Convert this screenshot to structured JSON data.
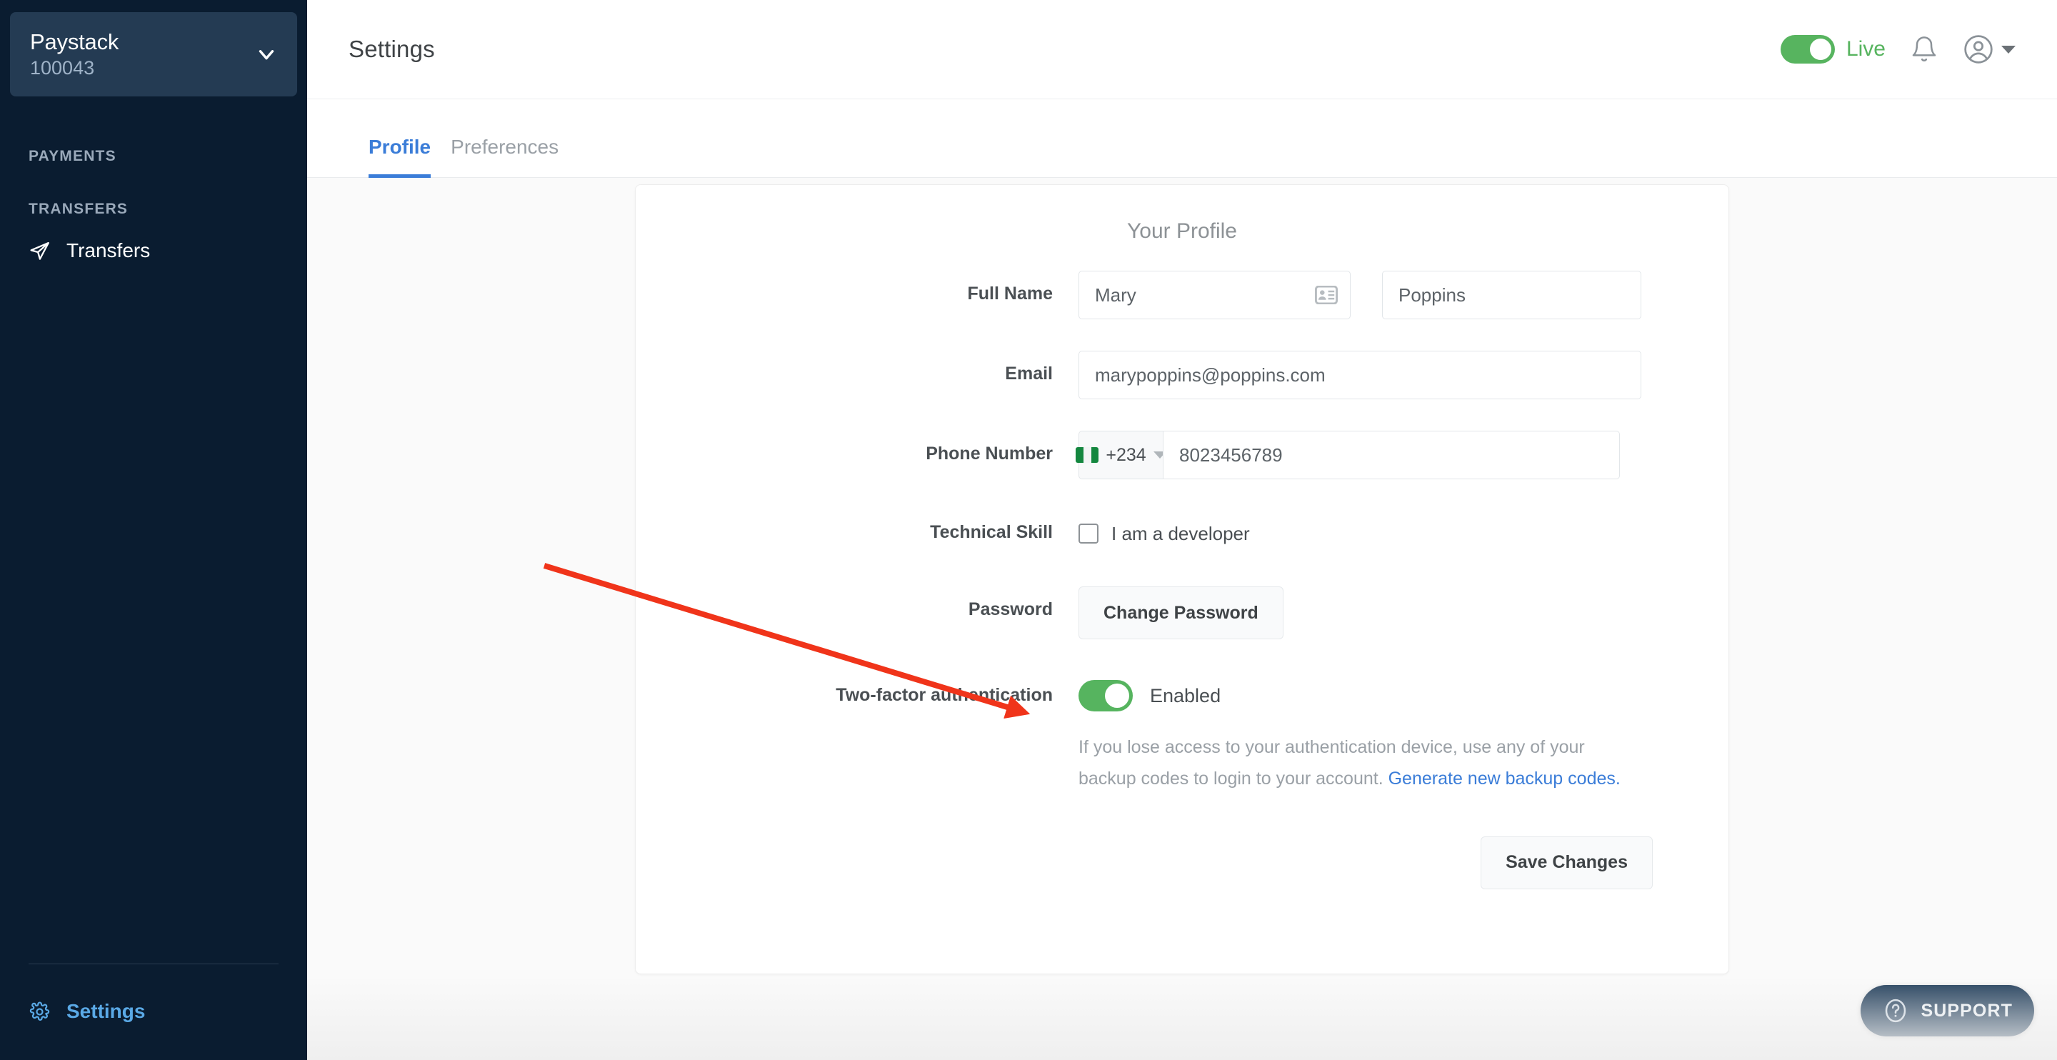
{
  "sidebar": {
    "account": {
      "name": "Paystack",
      "id": "100043",
      "chevron_icon": "chevron-down-icon"
    },
    "sections": [
      {
        "label": "PAYMENTS",
        "items": []
      },
      {
        "label": "TRANSFERS",
        "items": [
          {
            "label": "Transfers",
            "icon": "send-icon"
          }
        ]
      }
    ],
    "bottom": {
      "label": "Settings",
      "icon": "gear-icon"
    }
  },
  "header": {
    "title": "Settings",
    "mode_toggle": {
      "label": "Live",
      "state": "on",
      "color": "#57b45f"
    },
    "notifications_icon": "bell-icon",
    "account_icon": "user-circle-icon",
    "account_caret_icon": "caret-down-icon"
  },
  "tabs": [
    {
      "label": "Profile",
      "active": true
    },
    {
      "label": "Preferences",
      "active": false
    }
  ],
  "profile": {
    "card_title": "Your Profile",
    "full_name": {
      "label": "Full Name",
      "first_value": "Mary",
      "last_value": "Poppins",
      "autofill_icon": "contact-card-icon"
    },
    "email": {
      "label": "Email",
      "value": "marypoppins@poppins.com"
    },
    "phone": {
      "label": "Phone Number",
      "country_code": "+234",
      "flag_icon": "nigeria-flag-icon",
      "caret_icon": "caret-down-icon",
      "value": "8023456789"
    },
    "technical_skill": {
      "label": "Technical Skill",
      "checkbox_label": "I am a developer",
      "checked": false
    },
    "password": {
      "label": "Password",
      "button_label": "Change Password"
    },
    "two_factor": {
      "label": "Two-factor authentication",
      "state_label": "Enabled",
      "enabled": true,
      "help_text_before": "If you lose access to your authentication device, use any of your backup codes to login to your account. ",
      "help_link_text": "Generate new backup codes.",
      "toggle_color": "#56b45f",
      "link_color": "#3b7dd8"
    },
    "save_button": "Save Changes"
  },
  "support": {
    "label": "SUPPORT",
    "icon": "question-circle-icon"
  },
  "annotation": {
    "type": "arrow",
    "color": "#f0341a",
    "points": "from (760,792) to (1448,1002)"
  }
}
